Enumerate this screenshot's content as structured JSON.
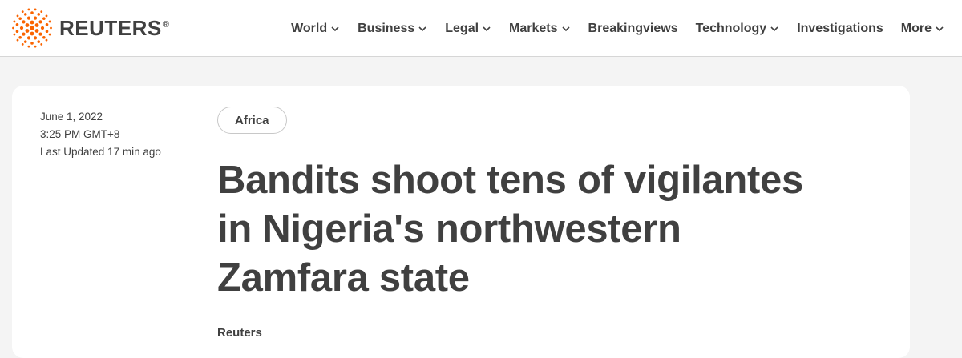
{
  "brand": {
    "name": "REUTERS",
    "registered_mark": "®",
    "logo_icon": "reuters-dot-sphere-logo",
    "logo_color": "#fa6400"
  },
  "nav": {
    "items": [
      {
        "label": "World",
        "dropdown": true
      },
      {
        "label": "Business",
        "dropdown": true
      },
      {
        "label": "Legal",
        "dropdown": true
      },
      {
        "label": "Markets",
        "dropdown": true
      },
      {
        "label": "Breakingviews",
        "dropdown": false
      },
      {
        "label": "Technology",
        "dropdown": true
      },
      {
        "label": "Investigations",
        "dropdown": false
      },
      {
        "label": "More",
        "dropdown": true
      }
    ]
  },
  "article": {
    "date": "June 1, 2022",
    "time": "3:25 PM GMT+8",
    "last_updated": "Last Updated 17 min ago",
    "section_tag": "Africa",
    "headline_lines": [
      "Bandits shoot tens of vigilantes",
      "in Nigeria's northwestern",
      "Zamfara state"
    ],
    "byline": "Reuters"
  },
  "colors": {
    "text": "#404040",
    "page_background": "#f4f4f4",
    "card_background": "#ffffff",
    "accent": "#fa6400"
  }
}
